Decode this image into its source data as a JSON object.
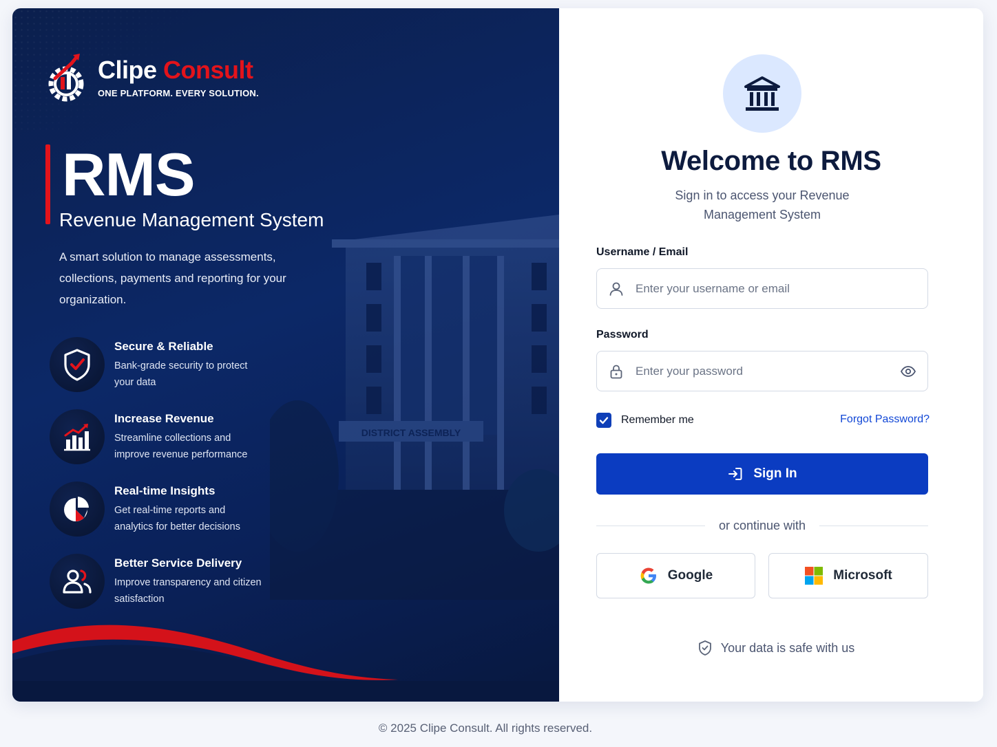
{
  "brand": {
    "name_part1": "Clipe",
    "name_part2": "Consult",
    "tagline": "ONE PLATFORM. EVERY SOLUTION.",
    "accent_color": "#e3131b"
  },
  "hero": {
    "title": "RMS",
    "subtitle": "Revenue Management System",
    "description": "A smart solution to manage assessments, collections, payments and reporting for your organization."
  },
  "features": [
    {
      "icon": "shield-check-icon",
      "title": "Secure & Reliable",
      "desc": "Bank-grade security to protect your data"
    },
    {
      "icon": "bar-chart-growth-icon",
      "title": "Increase Revenue",
      "desc": "Streamline collections and improve revenue performance"
    },
    {
      "icon": "pie-chart-icon",
      "title": "Real-time Insights",
      "desc": "Get real-time reports and analytics for better decisions"
    },
    {
      "icon": "users-icon",
      "title": "Better Service Delivery",
      "desc": "Improve transparency and citizen satisfaction"
    }
  ],
  "building_sign": "DISTRICT ASSEMBLY",
  "login": {
    "icon": "bank-building-icon",
    "title": "Welcome to RMS",
    "subtitle": "Sign in to access your Revenue Management System",
    "username_label": "Username / Email",
    "username_placeholder": "Enter your username or email",
    "password_label": "Password",
    "password_placeholder": "Enter your password",
    "remember_label": "Remember me",
    "remember_checked": true,
    "forgot_label": "Forgot Password?",
    "signin_label": "Sign In",
    "divider_text": "or continue with",
    "google_label": "Google",
    "microsoft_label": "Microsoft",
    "safe_text": "Your data is safe with us",
    "primary_color": "#0b3cc1"
  },
  "footer": {
    "copyright": "© 2025 Clipe Consult. All rights reserved."
  }
}
